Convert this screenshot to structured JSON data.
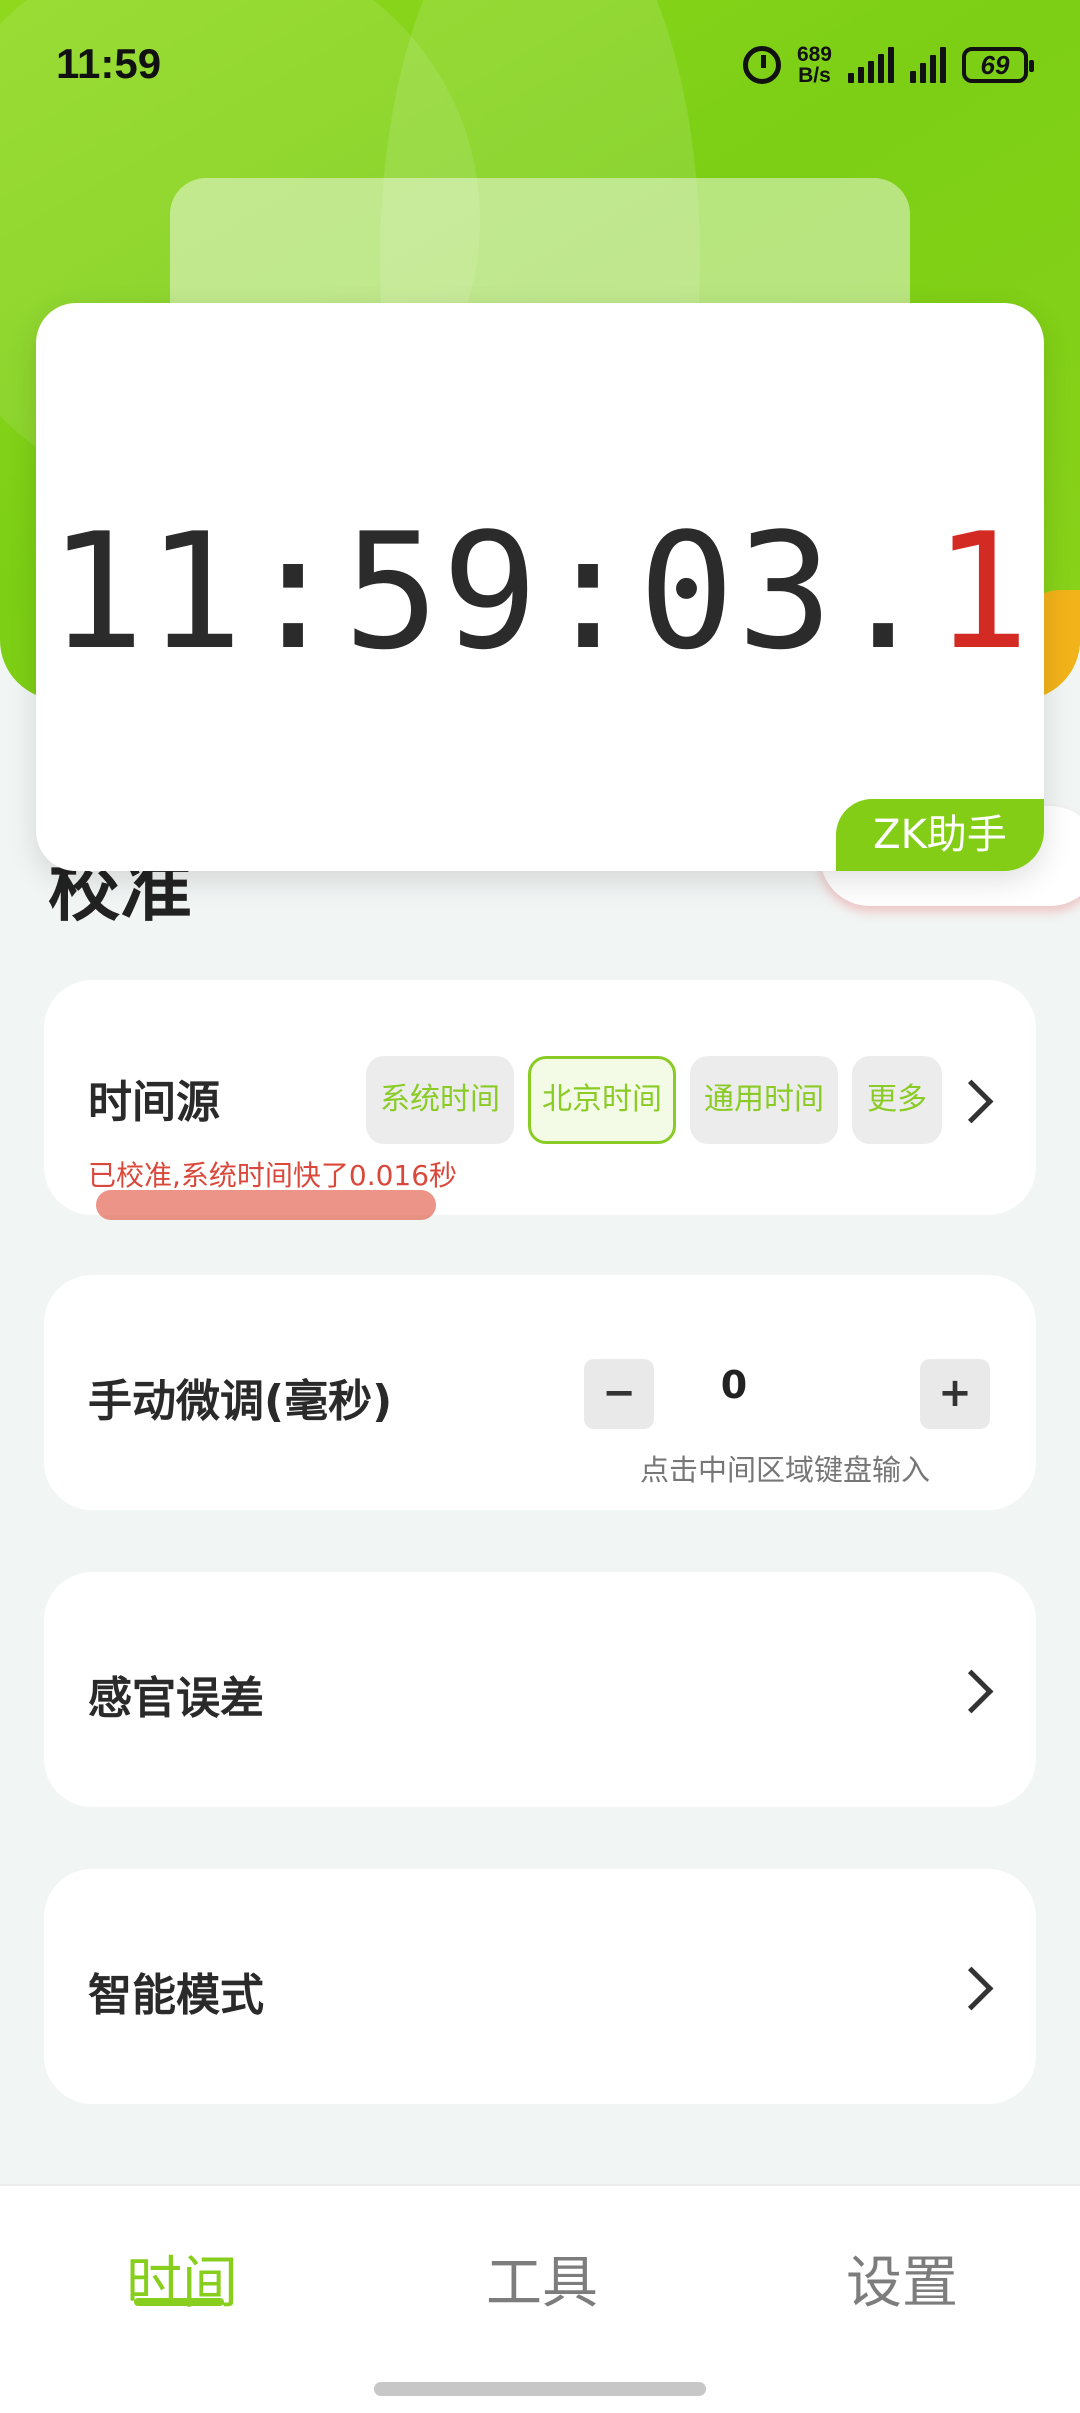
{
  "status_bar": {
    "time": "11:59",
    "net_speed_value": "689",
    "net_speed_unit": "B/s",
    "battery": "69",
    "icons": [
      "alarm-icon",
      "signal-icon",
      "signal-icon",
      "battery-icon"
    ]
  },
  "clock": {
    "main": "11:59:03.",
    "tenth": "1",
    "badge": "ZK助手",
    "tenth_color": "#d42a24"
  },
  "behind_title": "校准",
  "time_source": {
    "title": "时间源",
    "options": [
      "系统时间",
      "北京时间",
      "通用时间",
      "更多"
    ],
    "selected": "北京时间",
    "status": "已校准,系统时间快了0.016秒"
  },
  "manual_adjust": {
    "title": "手动微调(毫秒)",
    "minus": "−",
    "value": "0",
    "plus": "+",
    "hint": "点击中间区域键盘输入"
  },
  "sensory_error": {
    "title": "感官误差"
  },
  "smart_mode": {
    "title": "智能模式"
  },
  "nav": {
    "items": [
      "时间",
      "工具",
      "设置"
    ],
    "active": "时间",
    "accent": "#87cf1c"
  }
}
